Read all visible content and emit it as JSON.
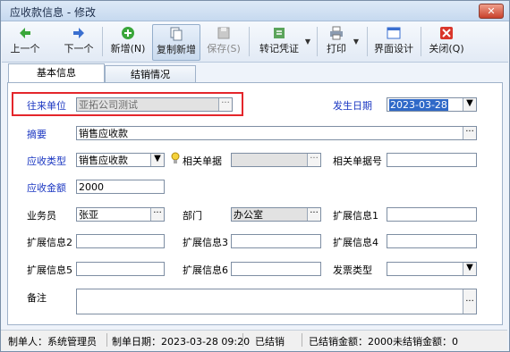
{
  "window": {
    "title": "应收款信息 - 修改",
    "close": "✕"
  },
  "toolbar": {
    "prev": "上一个",
    "next": "下一个",
    "add": "新增(N)",
    "copy_add": "复制新增",
    "save": "保存(S)",
    "transfer_voucher": "转记凭证",
    "print": "打印",
    "interface_design": "界面设计",
    "close": "关闭(Q)"
  },
  "tabs": [
    "基本信息",
    "结销情况"
  ],
  "form": {
    "partner_label": "往来单位",
    "partner_value": "亚拓公司测试",
    "date_label": "发生日期",
    "date_value": "2023-03-28",
    "summary_label": "摘要",
    "summary_value": "销售应收款",
    "type_label": "应收类型",
    "type_value": "销售应收款",
    "related_doc_label": "相关单据",
    "related_doc_value": "",
    "related_no_label": "相关单据号",
    "related_no_value": "",
    "amount_label": "应收金额",
    "amount_value": "2000",
    "salesman_label": "业务员",
    "salesman_value": "张亚",
    "dept_label": "部门",
    "dept_value": "办公室",
    "ext1_label": "扩展信息1",
    "ext2_label": "扩展信息2",
    "ext3_label": "扩展信息3",
    "ext4_label": "扩展信息4",
    "ext5_label": "扩展信息5",
    "ext6_label": "扩展信息6",
    "invoice_type_label": "发票类型",
    "note_label": "备注",
    "ellipsis": "···",
    "dropdown": "▼"
  },
  "status": {
    "maker": "制单人：系统管理员",
    "make_date": "制单日期：2023-03-28 09:20",
    "state": "已结销",
    "settled": "已结销金额：2000",
    "unsettled": "未结销金额：0"
  },
  "colors": {
    "required_label": "#1b37c2",
    "highlight_box": "#e4262b",
    "selection": "#2f69c8"
  }
}
